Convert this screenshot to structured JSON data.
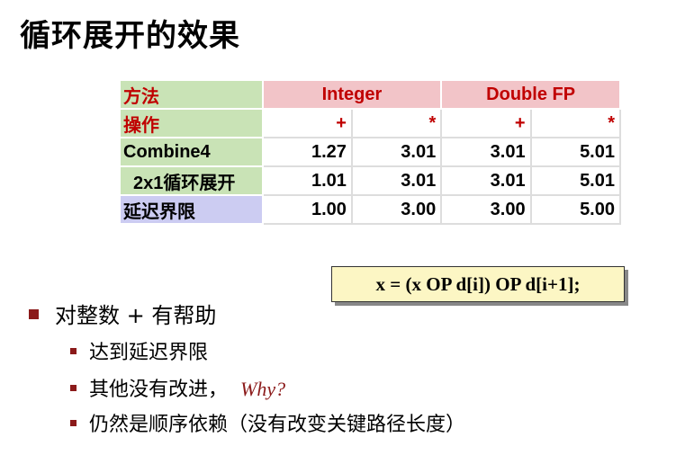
{
  "title": "循环展开的效果",
  "table": {
    "header_row": {
      "label": "方法",
      "groups": [
        "Integer",
        "Double FP"
      ]
    },
    "op_row": {
      "label": "操作",
      "ops": [
        "+",
        "*",
        "+",
        "*"
      ]
    },
    "rows": [
      {
        "label": "Combine4",
        "values": [
          "1.27",
          "3.01",
          "3.01",
          "5.01"
        ]
      },
      {
        "label": "2x1循环展开",
        "values": [
          "1.01",
          "3.01",
          "3.01",
          "5.01"
        ]
      },
      {
        "label": "延迟界限",
        "values": [
          "1.00",
          "3.00",
          "3.00",
          "5.00"
        ]
      }
    ]
  },
  "formula": "x = (x OP d[i]) OP d[i+1];",
  "bullets": {
    "main": "对整数 + 有帮助",
    "sub": [
      {
        "text": "达到延迟界限",
        "note": ""
      },
      {
        "text": "其他没有改进，",
        "note": "Why?"
      },
      {
        "text": "仍然是顺序依赖（没有改变关键路径长度）",
        "note": ""
      }
    ]
  },
  "colors": {
    "header_bg": "#f2c4c8",
    "label_green": "#c9e3b6",
    "label_blue": "#ccccf2",
    "accent_red": "#c00000",
    "formula_bg": "#fcf6c4",
    "bullet": "#8b1a1a"
  }
}
